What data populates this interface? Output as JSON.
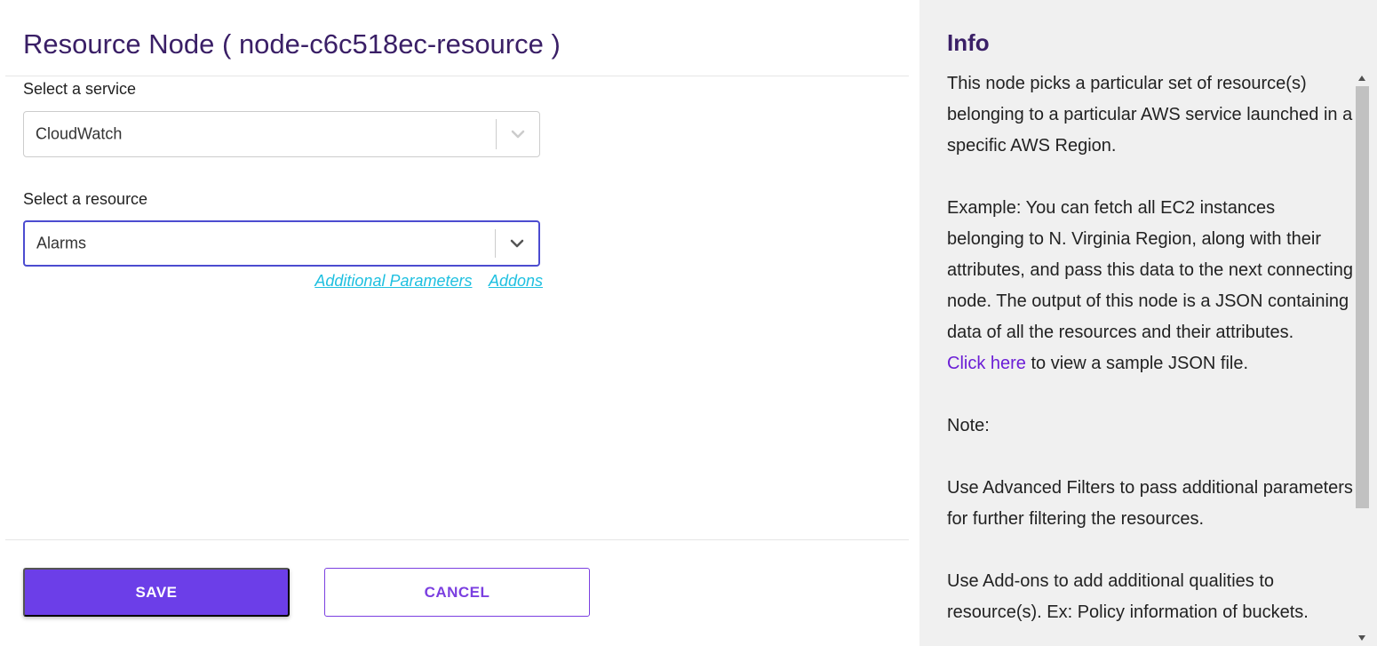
{
  "header": {
    "title": "Resource Node ( node-c6c518ec-resource )"
  },
  "form": {
    "service": {
      "label": "Select a service",
      "value": "CloudWatch"
    },
    "resource": {
      "label": "Select a resource",
      "value": "Alarms"
    },
    "links": {
      "additional_parameters": "Additional Parameters",
      "addons": "Addons"
    }
  },
  "buttons": {
    "save_label": "SAVE",
    "cancel_label": "CANCEL"
  },
  "info": {
    "title": "Info",
    "para1": "This node picks a particular set of resource(s) belonging to a particular AWS service launched in a specific AWS Region.",
    "para2": "Example: You can fetch all EC2 instances belonging to N. Virginia Region, along with their attributes, and pass this data to the next connecting node. The output of this node is a JSON containing data of all the resources and their attributes.",
    "click_here": "Click here",
    "click_suffix": " to view a sample JSON file.",
    "note_label": "Note:",
    "para3": "Use Advanced Filters to pass additional parameters for further filtering the resources.",
    "para4": "Use Add-ons to add additional qualities to resource(s). Ex: Policy information of buckets."
  },
  "colors": {
    "accent": "#6c3ee8",
    "title": "#3a1f66",
    "link": "#1fc0e0",
    "focus_border": "#4c4cd0"
  }
}
